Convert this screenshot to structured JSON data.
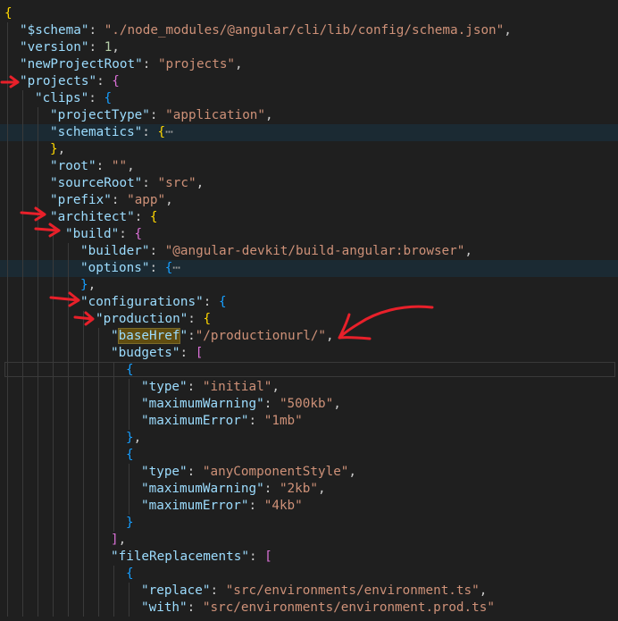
{
  "colors": {
    "background": "#1f1f1f",
    "key": "#9cdcfe",
    "string": "#ce9178",
    "number": "#b5cea8",
    "bracket_level_1": "#ffd700",
    "bracket_level_2": "#da70d6",
    "bracket_level_3": "#179fff",
    "annotation": "#e8202a"
  },
  "fold_ellipsis": "⋯",
  "lines": [
    {
      "indent": 0,
      "tokens": [
        [
          "b1",
          "{"
        ]
      ]
    },
    {
      "indent": 1,
      "tokens": [
        [
          "k",
          "\"$schema\""
        ],
        [
          "p",
          ": "
        ],
        [
          "s",
          "\"./node_modules/@angular/cli/lib/config/schema.json\""
        ],
        [
          "p",
          ","
        ]
      ]
    },
    {
      "indent": 1,
      "tokens": [
        [
          "k",
          "\"version\""
        ],
        [
          "p",
          ": "
        ],
        [
          "n",
          "1"
        ],
        [
          "p",
          ","
        ]
      ]
    },
    {
      "indent": 1,
      "tokens": [
        [
          "k",
          "\"newProjectRoot\""
        ],
        [
          "p",
          ": "
        ],
        [
          "s",
          "\"projects\""
        ],
        [
          "p",
          ","
        ]
      ]
    },
    {
      "indent": 1,
      "tokens": [
        [
          "k",
          "\"projects\""
        ],
        [
          "p",
          ": "
        ],
        [
          "b2",
          "{"
        ]
      ]
    },
    {
      "indent": 2,
      "tokens": [
        [
          "k",
          "\"clips\""
        ],
        [
          "p",
          ": "
        ],
        [
          "b3",
          "{"
        ]
      ]
    },
    {
      "indent": 3,
      "tokens": [
        [
          "k",
          "\"projectType\""
        ],
        [
          "p",
          ": "
        ],
        [
          "s",
          "\"application\""
        ],
        [
          "p",
          ","
        ]
      ]
    },
    {
      "indent": 3,
      "hl": true,
      "tokens": [
        [
          "k",
          "\"schematics\""
        ],
        [
          "p",
          ": "
        ],
        [
          "b1",
          "{"
        ],
        [
          "fold",
          "⋯"
        ]
      ]
    },
    {
      "indent": 3,
      "tokens": [
        [
          "b1",
          "}"
        ],
        [
          "p",
          ","
        ]
      ]
    },
    {
      "indent": 3,
      "tokens": [
        [
          "k",
          "\"root\""
        ],
        [
          "p",
          ": "
        ],
        [
          "s",
          "\"\""
        ],
        [
          "p",
          ","
        ]
      ]
    },
    {
      "indent": 3,
      "tokens": [
        [
          "k",
          "\"sourceRoot\""
        ],
        [
          "p",
          ": "
        ],
        [
          "s",
          "\"src\""
        ],
        [
          "p",
          ","
        ]
      ]
    },
    {
      "indent": 3,
      "tokens": [
        [
          "k",
          "\"prefix\""
        ],
        [
          "p",
          ": "
        ],
        [
          "s",
          "\"app\""
        ],
        [
          "p",
          ","
        ]
      ]
    },
    {
      "indent": 3,
      "tokens": [
        [
          "k",
          "\"architect\""
        ],
        [
          "p",
          ": "
        ],
        [
          "b1",
          "{"
        ]
      ]
    },
    {
      "indent": 4,
      "tokens": [
        [
          "k",
          "\"build\""
        ],
        [
          "p",
          ": "
        ],
        [
          "b2",
          "{"
        ]
      ]
    },
    {
      "indent": 5,
      "tokens": [
        [
          "k",
          "\"builder\""
        ],
        [
          "p",
          ": "
        ],
        [
          "s",
          "\"@angular-devkit/build-angular:browser\""
        ],
        [
          "p",
          ","
        ]
      ]
    },
    {
      "indent": 5,
      "hl": true,
      "tokens": [
        [
          "k",
          "\"options\""
        ],
        [
          "p",
          ": "
        ],
        [
          "b3",
          "{"
        ],
        [
          "fold",
          "⋯"
        ]
      ]
    },
    {
      "indent": 5,
      "tokens": [
        [
          "b3",
          "}"
        ],
        [
          "p",
          ","
        ]
      ]
    },
    {
      "indent": 5,
      "tokens": [
        [
          "k",
          "\"configurations\""
        ],
        [
          "p",
          ": "
        ],
        [
          "b3",
          "{"
        ]
      ]
    },
    {
      "indent": 6,
      "tokens": [
        [
          "k",
          "\"production\""
        ],
        [
          "p",
          ": "
        ],
        [
          "b1",
          "{"
        ]
      ]
    },
    {
      "indent": 7,
      "tokens": [
        [
          "k",
          "\""
        ],
        [
          "ksel",
          "baseHref"
        ],
        [
          "k",
          "\""
        ],
        [
          "p",
          ":"
        ],
        [
          "s",
          "\"/productionurl/\""
        ],
        [
          "p",
          ","
        ]
      ]
    },
    {
      "indent": 7,
      "tokens": [
        [
          "k",
          "\"budgets\""
        ],
        [
          "p",
          ": "
        ],
        [
          "b2",
          "["
        ]
      ]
    },
    {
      "indent": 8,
      "tokens": [
        [
          "b3",
          "{"
        ]
      ]
    },
    {
      "indent": 9,
      "tokens": [
        [
          "k",
          "\"type\""
        ],
        [
          "p",
          ": "
        ],
        [
          "s",
          "\"initial\""
        ],
        [
          "p",
          ","
        ]
      ]
    },
    {
      "indent": 9,
      "tokens": [
        [
          "k",
          "\"maximumWarning\""
        ],
        [
          "p",
          ": "
        ],
        [
          "s",
          "\"500kb\""
        ],
        [
          "p",
          ","
        ]
      ]
    },
    {
      "indent": 9,
      "tokens": [
        [
          "k",
          "\"maximumError\""
        ],
        [
          "p",
          ": "
        ],
        [
          "s",
          "\"1mb\""
        ]
      ]
    },
    {
      "indent": 8,
      "tokens": [
        [
          "b3",
          "}"
        ],
        [
          "p",
          ","
        ]
      ]
    },
    {
      "indent": 8,
      "tokens": [
        [
          "b3",
          "{"
        ]
      ]
    },
    {
      "indent": 9,
      "tokens": [
        [
          "k",
          "\"type\""
        ],
        [
          "p",
          ": "
        ],
        [
          "s",
          "\"anyComponentStyle\""
        ],
        [
          "p",
          ","
        ]
      ]
    },
    {
      "indent": 9,
      "tokens": [
        [
          "k",
          "\"maximumWarning\""
        ],
        [
          "p",
          ": "
        ],
        [
          "s",
          "\"2kb\""
        ],
        [
          "p",
          ","
        ]
      ]
    },
    {
      "indent": 9,
      "tokens": [
        [
          "k",
          "\"maximumError\""
        ],
        [
          "p",
          ": "
        ],
        [
          "s",
          "\"4kb\""
        ]
      ]
    },
    {
      "indent": 8,
      "tokens": [
        [
          "b3",
          "}"
        ]
      ]
    },
    {
      "indent": 7,
      "tokens": [
        [
          "b2",
          "]"
        ],
        [
          "p",
          ","
        ]
      ]
    },
    {
      "indent": 7,
      "tokens": [
        [
          "k",
          "\"fileReplacements\""
        ],
        [
          "p",
          ": "
        ],
        [
          "b2",
          "["
        ]
      ]
    },
    {
      "indent": 8,
      "tokens": [
        [
          "b3",
          "{"
        ]
      ]
    },
    {
      "indent": 9,
      "tokens": [
        [
          "k",
          "\"replace\""
        ],
        [
          "p",
          ": "
        ],
        [
          "s",
          "\"src/environments/environment.ts\""
        ],
        [
          "p",
          ","
        ]
      ]
    },
    {
      "indent": 9,
      "tokens": [
        [
          "k",
          "\"with\""
        ],
        [
          "p",
          ": "
        ],
        [
          "s",
          "\"src/environments/environment.prod.ts\""
        ]
      ]
    }
  ]
}
